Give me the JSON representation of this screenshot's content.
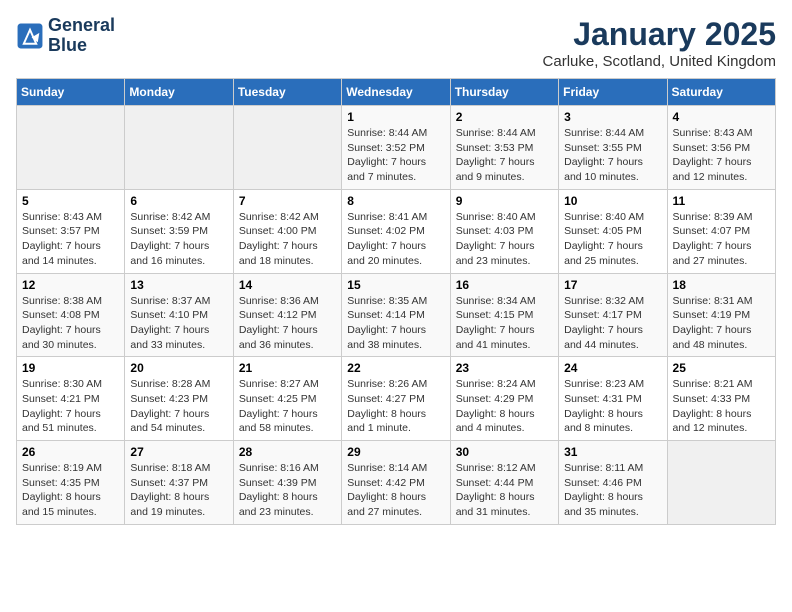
{
  "logo": {
    "line1": "General",
    "line2": "Blue"
  },
  "title": "January 2025",
  "subtitle": "Carluke, Scotland, United Kingdom",
  "days_of_week": [
    "Sunday",
    "Monday",
    "Tuesday",
    "Wednesday",
    "Thursday",
    "Friday",
    "Saturday"
  ],
  "weeks": [
    [
      {
        "day": "",
        "info": ""
      },
      {
        "day": "",
        "info": ""
      },
      {
        "day": "",
        "info": ""
      },
      {
        "day": "1",
        "sunrise": "8:44 AM",
        "sunset": "3:52 PM",
        "daylight": "7 hours and 7 minutes."
      },
      {
        "day": "2",
        "sunrise": "8:44 AM",
        "sunset": "3:53 PM",
        "daylight": "7 hours and 9 minutes."
      },
      {
        "day": "3",
        "sunrise": "8:44 AM",
        "sunset": "3:55 PM",
        "daylight": "7 hours and 10 minutes."
      },
      {
        "day": "4",
        "sunrise": "8:43 AM",
        "sunset": "3:56 PM",
        "daylight": "7 hours and 12 minutes."
      }
    ],
    [
      {
        "day": "5",
        "sunrise": "8:43 AM",
        "sunset": "3:57 PM",
        "daylight": "7 hours and 14 minutes."
      },
      {
        "day": "6",
        "sunrise": "8:42 AM",
        "sunset": "3:59 PM",
        "daylight": "7 hours and 16 minutes."
      },
      {
        "day": "7",
        "sunrise": "8:42 AM",
        "sunset": "4:00 PM",
        "daylight": "7 hours and 18 minutes."
      },
      {
        "day": "8",
        "sunrise": "8:41 AM",
        "sunset": "4:02 PM",
        "daylight": "7 hours and 20 minutes."
      },
      {
        "day": "9",
        "sunrise": "8:40 AM",
        "sunset": "4:03 PM",
        "daylight": "7 hours and 23 minutes."
      },
      {
        "day": "10",
        "sunrise": "8:40 AM",
        "sunset": "4:05 PM",
        "daylight": "7 hours and 25 minutes."
      },
      {
        "day": "11",
        "sunrise": "8:39 AM",
        "sunset": "4:07 PM",
        "daylight": "7 hours and 27 minutes."
      }
    ],
    [
      {
        "day": "12",
        "sunrise": "8:38 AM",
        "sunset": "4:08 PM",
        "daylight": "7 hours and 30 minutes."
      },
      {
        "day": "13",
        "sunrise": "8:37 AM",
        "sunset": "4:10 PM",
        "daylight": "7 hours and 33 minutes."
      },
      {
        "day": "14",
        "sunrise": "8:36 AM",
        "sunset": "4:12 PM",
        "daylight": "7 hours and 36 minutes."
      },
      {
        "day": "15",
        "sunrise": "8:35 AM",
        "sunset": "4:14 PM",
        "daylight": "7 hours and 38 minutes."
      },
      {
        "day": "16",
        "sunrise": "8:34 AM",
        "sunset": "4:15 PM",
        "daylight": "7 hours and 41 minutes."
      },
      {
        "day": "17",
        "sunrise": "8:32 AM",
        "sunset": "4:17 PM",
        "daylight": "7 hours and 44 minutes."
      },
      {
        "day": "18",
        "sunrise": "8:31 AM",
        "sunset": "4:19 PM",
        "daylight": "7 hours and 48 minutes."
      }
    ],
    [
      {
        "day": "19",
        "sunrise": "8:30 AM",
        "sunset": "4:21 PM",
        "daylight": "7 hours and 51 minutes."
      },
      {
        "day": "20",
        "sunrise": "8:28 AM",
        "sunset": "4:23 PM",
        "daylight": "7 hours and 54 minutes."
      },
      {
        "day": "21",
        "sunrise": "8:27 AM",
        "sunset": "4:25 PM",
        "daylight": "7 hours and 58 minutes."
      },
      {
        "day": "22",
        "sunrise": "8:26 AM",
        "sunset": "4:27 PM",
        "daylight": "8 hours and 1 minute."
      },
      {
        "day": "23",
        "sunrise": "8:24 AM",
        "sunset": "4:29 PM",
        "daylight": "8 hours and 4 minutes."
      },
      {
        "day": "24",
        "sunrise": "8:23 AM",
        "sunset": "4:31 PM",
        "daylight": "8 hours and 8 minutes."
      },
      {
        "day": "25",
        "sunrise": "8:21 AM",
        "sunset": "4:33 PM",
        "daylight": "8 hours and 12 minutes."
      }
    ],
    [
      {
        "day": "26",
        "sunrise": "8:19 AM",
        "sunset": "4:35 PM",
        "daylight": "8 hours and 15 minutes."
      },
      {
        "day": "27",
        "sunrise": "8:18 AM",
        "sunset": "4:37 PM",
        "daylight": "8 hours and 19 minutes."
      },
      {
        "day": "28",
        "sunrise": "8:16 AM",
        "sunset": "4:39 PM",
        "daylight": "8 hours and 23 minutes."
      },
      {
        "day": "29",
        "sunrise": "8:14 AM",
        "sunset": "4:42 PM",
        "daylight": "8 hours and 27 minutes."
      },
      {
        "day": "30",
        "sunrise": "8:12 AM",
        "sunset": "4:44 PM",
        "daylight": "8 hours and 31 minutes."
      },
      {
        "day": "31",
        "sunrise": "8:11 AM",
        "sunset": "4:46 PM",
        "daylight": "8 hours and 35 minutes."
      },
      {
        "day": "",
        "info": ""
      }
    ]
  ]
}
